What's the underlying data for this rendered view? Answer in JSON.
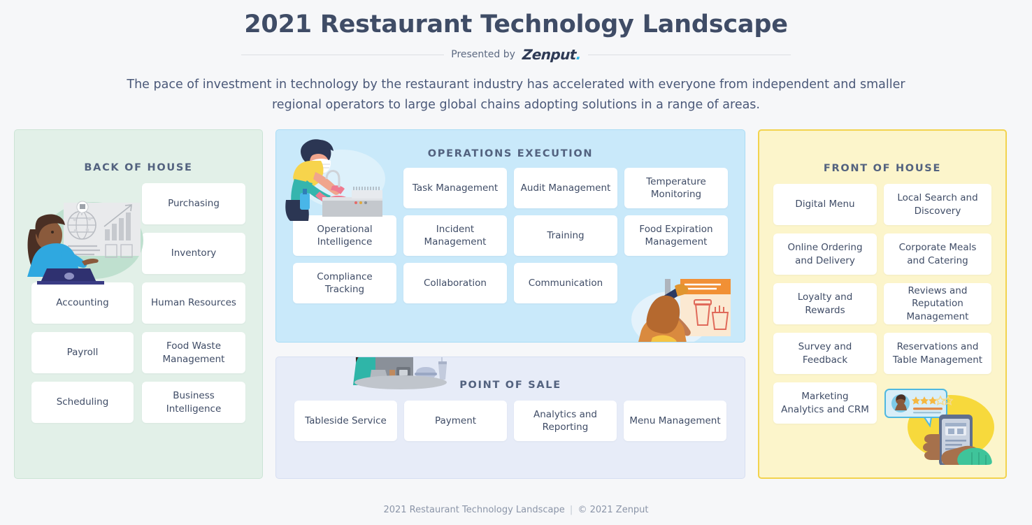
{
  "header": {
    "title": "2021 Restaurant Technology Landscape",
    "presented_by": "Presented by",
    "brand": "Zenput",
    "brand_dot": ".",
    "subtitle": "The pace of investment in technology by the restaurant industry has accelerated with everyone from independent and smaller regional operators to large global chains adopting solutions in a range of areas."
  },
  "panels": {
    "back_of_house": {
      "title": "BACK OF HOUSE",
      "bg_color": "#e2f0e8",
      "border_color": "#cbe4d5",
      "illustration": "woman-at-laptop-with-dashboard",
      "tiles": [
        "Purchasing",
        "Inventory",
        "Accounting",
        "Human Resources",
        "Payroll",
        "Food Waste Management",
        "Scheduling",
        "Business Intelligence"
      ]
    },
    "operations_execution": {
      "title": "OPERATIONS EXECUTION",
      "bg_color": "#c9e9fa",
      "border_color": "#a9dcf5",
      "illustration_left": "masked-worker-cleaning-counter",
      "illustration_right": "woman-hanging-promo-poster",
      "tiles": [
        "Task Management",
        "Audit Management",
        "Temperature Monitoring",
        "Operational Intelligence",
        "Incident Management",
        "Training",
        "Food Expiration Management",
        "Compliance Tracking",
        "Collaboration",
        "Communication"
      ]
    },
    "point_of_sale": {
      "title": "POINT OF SALE",
      "bg_color": "#e7ecf8",
      "border_color": "#d6def2",
      "illustration": "cashier-at-pos-terminal",
      "tiles": [
        "Tableside Service",
        "Payment",
        "Analytics and Reporting",
        "Menu Management"
      ]
    },
    "front_of_house": {
      "title": "FRONT OF HOUSE",
      "bg_color": "#fcf5cb",
      "border_color": "#f2d34e",
      "illustration": "hand-holding-phone-with-review",
      "tiles": [
        "Digital Menu",
        "Local Search and Discovery",
        "Online Ordering and Delivery",
        "Corporate Meals and Catering",
        "Loyalty and Rewards",
        "Reviews and Reputation Management",
        "Survey and Feedback",
        "Reservations and Table Management",
        "Marketing Analytics and CRM"
      ]
    }
  },
  "footer": {
    "title": "2021 Restaurant Technology Landscape",
    "separator": "|",
    "copyright": "© 2021 Zenput"
  }
}
